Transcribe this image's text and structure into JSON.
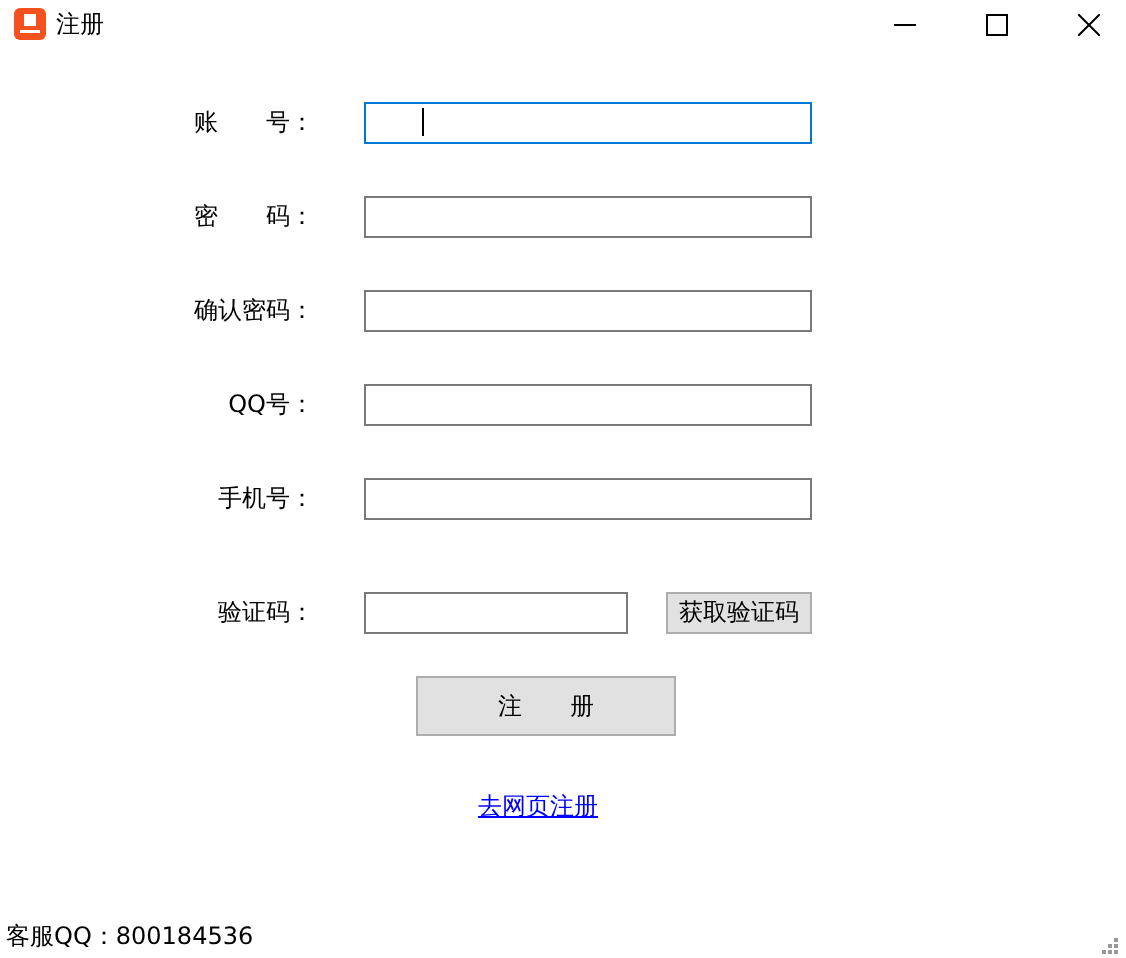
{
  "window": {
    "title": "注册"
  },
  "fields": [
    {
      "label": "账　　号：",
      "focused": true,
      "kind": "text"
    },
    {
      "label": "密　　码：",
      "focused": false,
      "kind": "text"
    },
    {
      "label": "确认密码：",
      "focused": false,
      "kind": "text"
    },
    {
      "label": "QQ号：",
      "focused": false,
      "kind": "text"
    },
    {
      "label": "手机号：",
      "focused": false,
      "kind": "text"
    },
    {
      "label": "验证码：",
      "focused": false,
      "kind": "code",
      "button": "获取验证码"
    }
  ],
  "submit_button": "注　　册",
  "web_link": "去网页注册",
  "status_bar": "客服QQ：800184536"
}
